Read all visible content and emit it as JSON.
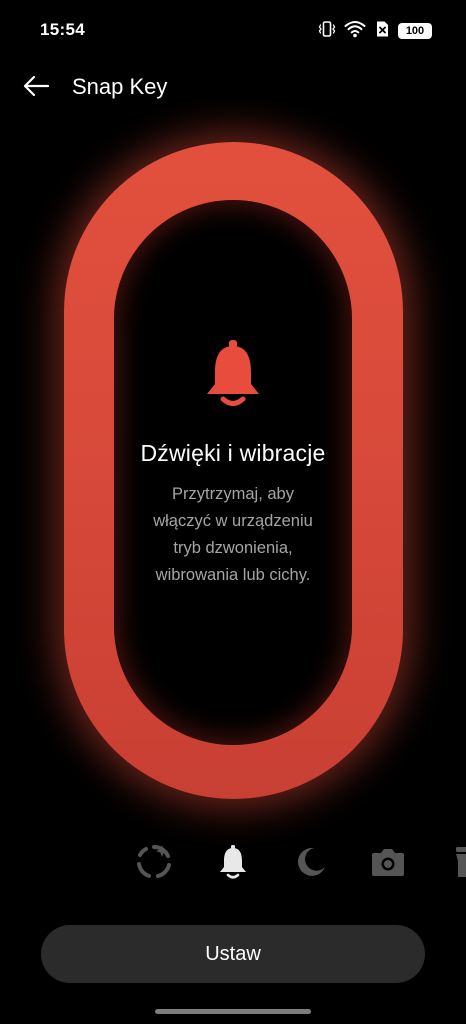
{
  "status_bar": {
    "time": "15:54",
    "battery": "100",
    "icons": [
      "vibrate-icon",
      "wifi-icon",
      "no-sim-icon",
      "battery-icon"
    ]
  },
  "header": {
    "back_icon": "arrow-left-icon",
    "title": "Snap Key"
  },
  "hero": {
    "accent_color": "#e2503d",
    "icon": "bell-icon",
    "title": "Dźwięki i wibracje",
    "description_lines": [
      "Przytrzymaj, aby",
      "włączyć w urządzeniu",
      "tryb dzwonienia,",
      "wibrowania lub cichy."
    ]
  },
  "mode_selector": {
    "items": [
      {
        "icon": "custom-action-icon",
        "selected": false
      },
      {
        "icon": "bell-icon",
        "selected": true
      },
      {
        "icon": "moon-icon",
        "selected": false
      },
      {
        "icon": "camera-icon",
        "selected": false
      },
      {
        "icon": "flashlight-icon",
        "selected": false
      }
    ]
  },
  "actions": {
    "set_label": "Ustaw"
  }
}
